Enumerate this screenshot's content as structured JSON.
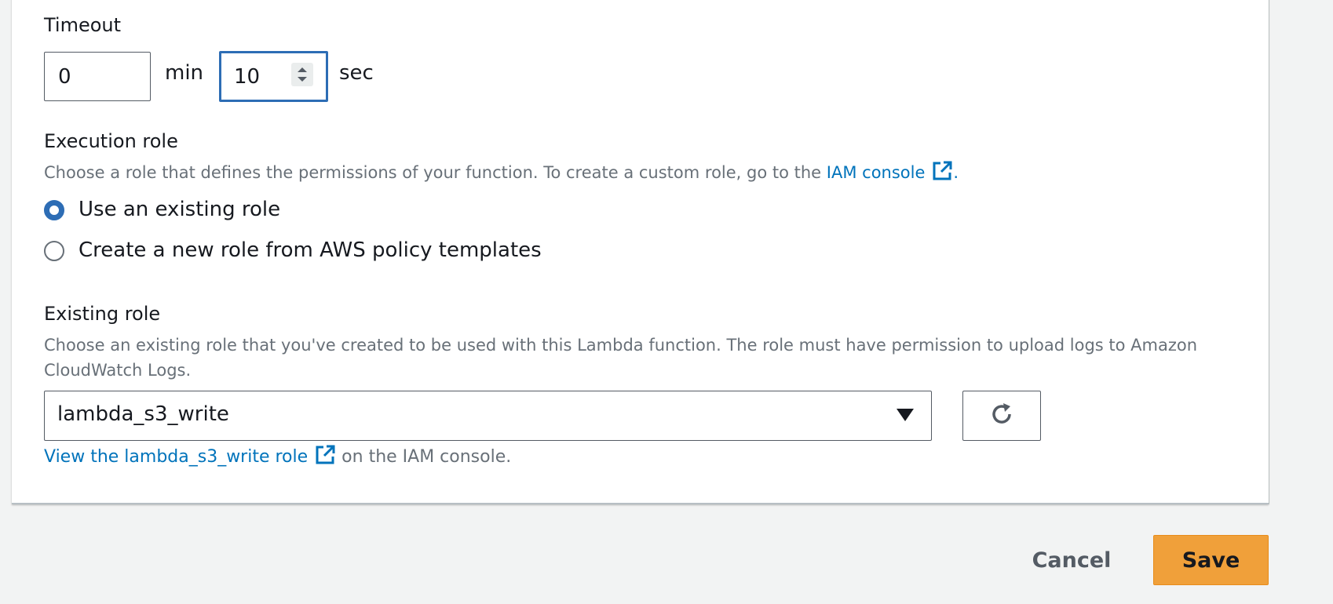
{
  "timeout": {
    "label": "Timeout",
    "minutes_value": "0",
    "min_unit": "min",
    "seconds_value": "10",
    "sec_unit": "sec"
  },
  "execution_role": {
    "label": "Execution role",
    "description": "Choose a role that defines the permissions of your function. To create a custom role, go to the",
    "iam_link": "IAM console",
    "trailing": ".",
    "options": [
      {
        "label": "Use an existing role",
        "selected": true
      },
      {
        "label": "Create a new role from AWS policy templates",
        "selected": false
      }
    ]
  },
  "existing_role": {
    "label": "Existing role",
    "description_line1": "Choose an existing role that you've created to be used with this Lambda function. The role must have permission to upload logs to Amazon",
    "description_line2": "CloudWatch Logs.",
    "selected_value": "lambda_s3_write",
    "view_link": "View the lambda_s3_write role",
    "view_suffix": "on the IAM console."
  },
  "actions": {
    "cancel_label": "Cancel",
    "save_label": "Save"
  },
  "colors": {
    "accent": "#2d6db5",
    "link": "#0073bb",
    "primary_button": "#f0a03a"
  },
  "icons": [
    "external-link-icon",
    "caret-down-icon",
    "refresh-icon",
    "spinner-arrows-icon"
  ]
}
